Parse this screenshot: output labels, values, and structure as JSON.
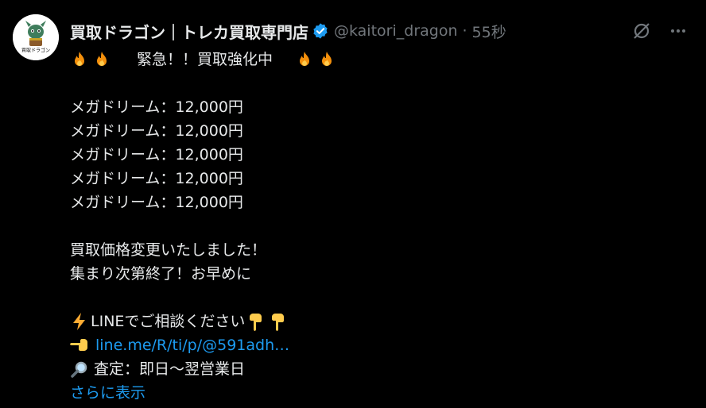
{
  "author": {
    "name": "買取ドラゴン｜トレカ買取専門店",
    "handle": "@kaitori_dragon",
    "separator": "·",
    "time": "55秒",
    "avatar_text": "買取ドラゴン"
  },
  "tweet": {
    "headline": "緊急！！買取強化中",
    "items": [
      "メガドリーム：12,000円",
      "メガドリーム：12,000円",
      "メガドリーム：12,000円",
      "メガドリーム：12,000円",
      "メガドリーム：12,000円"
    ],
    "message1": "買取価格変更いたしました！",
    "message2": "集まり次第終了！お早めに",
    "line_cta": "LINEでご相談ください",
    "link": "line.me/R/ti/p/@591adh…",
    "assessment": "査定：即日〜翌営業日",
    "show_more": "さらに表示"
  },
  "colors": {
    "accent": "#1d9bf0",
    "text": "#e7e9ea",
    "muted": "#71767b",
    "background": "#000000"
  },
  "icons": [
    "fire-icon",
    "verified-badge-icon",
    "grok-icon",
    "more-icon",
    "lightning-icon",
    "pointing-down-icon",
    "pointing-right-icon",
    "magnifier-icon"
  ]
}
